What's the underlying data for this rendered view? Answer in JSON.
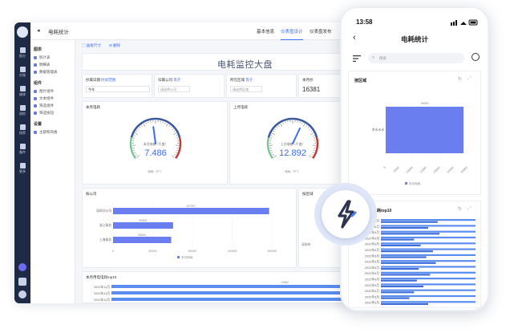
{
  "app": {
    "title": "电耗统计",
    "tabs": [
      "基本信息",
      "仪表盘设计",
      "仪表盘发布"
    ],
    "active_tab": 1,
    "nav": [
      {
        "icon": "chart-icon",
        "label": "报分"
      },
      {
        "icon": "table-icon",
        "label": "台账"
      },
      {
        "icon": "wrench-icon",
        "label": "维修"
      },
      {
        "icon": "report-icon",
        "label": "巡检"
      },
      {
        "icon": "list-icon",
        "label": "保养"
      },
      {
        "icon": "box-icon",
        "label": "备件"
      },
      {
        "icon": "grid-icon",
        "label": "更多"
      }
    ],
    "sidebar": {
      "sections": [
        {
          "title": "图表",
          "items": [
            "统计表",
            "明细表",
            "数据管理表"
          ]
        },
        {
          "title": "组件",
          "items": [
            "图片组件",
            "文本组件",
            "筛选组件",
            "筛选按钮"
          ]
        },
        {
          "title": "设置",
          "items": [
            "主题和风格"
          ]
        }
      ]
    },
    "toolbar": {
      "size": "画板尺寸",
      "delete": "删除"
    },
    "dashboard_title": "电耗监控大盘",
    "filters": [
      {
        "label": "抄属日期",
        "sub": "时间范围",
        "value": "今年"
      },
      {
        "label": "归属公司",
        "sub": "等于",
        "value": "请选择公司"
      },
      {
        "label": "所在区域",
        "sub": "等于",
        "value": "请选择区域"
      }
    ],
    "kpi": {
      "label": "本月抄",
      "value": "16381"
    },
    "gauges": [
      {
        "title": "本月电耗",
        "inner": "本月电耗（千度）",
        "value": "7.486",
        "display_ratio": 0.47,
        "unit": "电耗（千°）"
      },
      {
        "title": "上月电耗",
        "inner": "上月电耗（千度）",
        "value": "12.892",
        "display_ratio": 0.6,
        "unit": "电耗（千°）"
      }
    ],
    "company_chart": {
      "title": "按公司",
      "categories": [
        "深圳分公司",
        "浙江乘务",
        "上海乘务"
      ],
      "values": [
        157257,
        60506,
        58553
      ],
      "value_labels": [
        "157257",
        "60506",
        "58553"
      ],
      "xticks": [
        "0",
        "40000",
        "80000",
        "120000",
        "160000"
      ],
      "xmax": 160000,
      "legend": "本月电耗"
    },
    "region_panel": {
      "title": "按区域",
      "category": "深圳市"
    },
    "top10": {
      "title": "本月用电电耗top10",
      "labels": [
        "2022年11月",
        "2022年11月",
        "2022年11月"
      ],
      "value_label": "12862"
    }
  },
  "phone": {
    "time": "13:58",
    "title": "电耗统计",
    "search_placeholder": "搜索",
    "region_card": {
      "title": "按区域",
      "category": "杀水水水",
      "value": 28559,
      "value_label": "28559",
      "xticks": [
        "0",
        "5000",
        "10000",
        "15000",
        "20000",
        "25000",
        "30000"
      ],
      "xmax": 30000,
      "legend": "本月电耗"
    },
    "top10_card": {
      "title": "电耗top10",
      "labels": [
        "2022年6月",
        "2022年6月",
        "2022年6月",
        "2022年6月",
        "2022年6月",
        "2022年6月",
        "2022年6月",
        "2022年6月",
        "2022年6月",
        "2022年6月",
        "2022年6月",
        "2022年6月",
        "2022年6月",
        "2022年6月",
        "2022年6月"
      ]
    }
  },
  "colors": {
    "accent": "#3d6bf2",
    "bar": "#6a7ef0",
    "nav": "#1f2a44"
  }
}
